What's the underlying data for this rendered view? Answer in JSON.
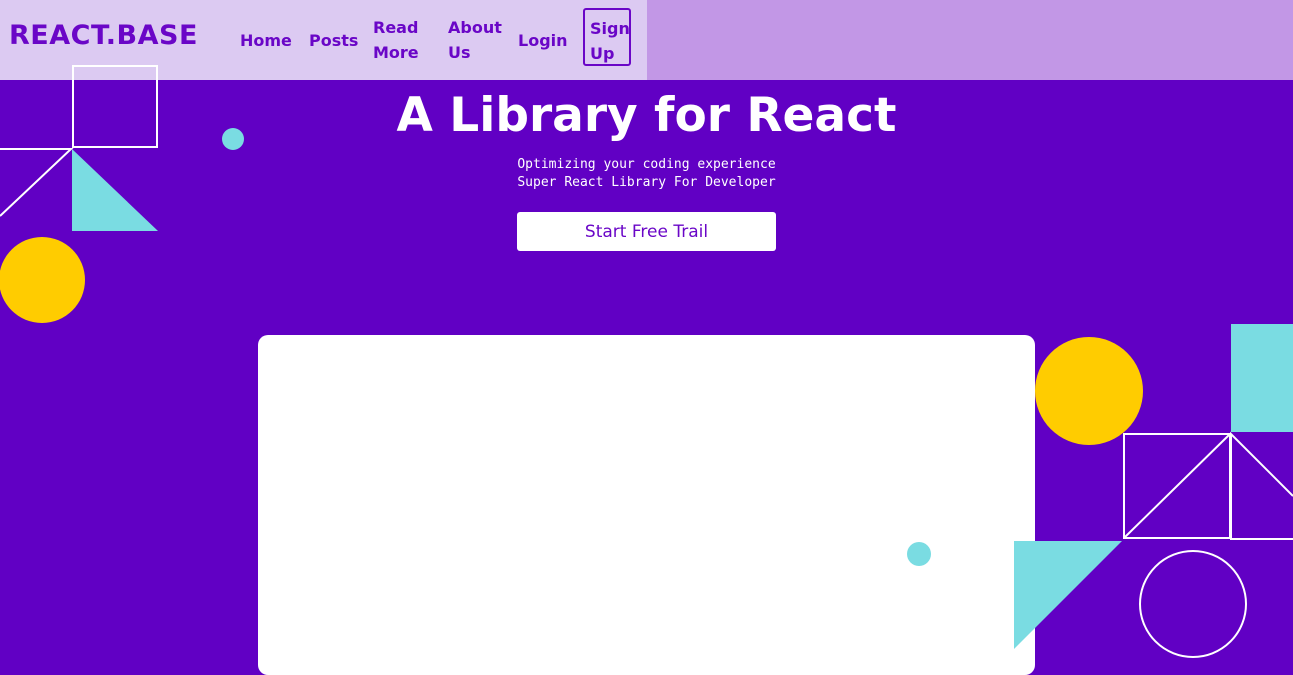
{
  "brand": {
    "logo": "REACT.BASE"
  },
  "nav": {
    "items": [
      {
        "label": "Home"
      },
      {
        "label": "Posts"
      },
      {
        "label": "Read More"
      },
      {
        "label": "About Us"
      },
      {
        "label": "Login"
      }
    ],
    "signup_label": "Sign Up"
  },
  "hero": {
    "title": "A Library for React",
    "subtitle_line1": "Optimizing your coding experience",
    "subtitle_line2": "Super React Library For Developer",
    "cta_label": "Start Free Trail"
  },
  "colors": {
    "background": "#6100c4",
    "header_right": "#c297e6",
    "nav_panel": "#dccaf2",
    "accent_purple": "#6a06c7",
    "yellow": "#ffcc00",
    "cyan": "#7adce2",
    "white": "#ffffff"
  },
  "decorations": {
    "shapes": [
      "square-outline",
      "triangle-cyan",
      "triangle-outline",
      "circle-yellow",
      "dot-cyan",
      "circle-outline"
    ]
  }
}
